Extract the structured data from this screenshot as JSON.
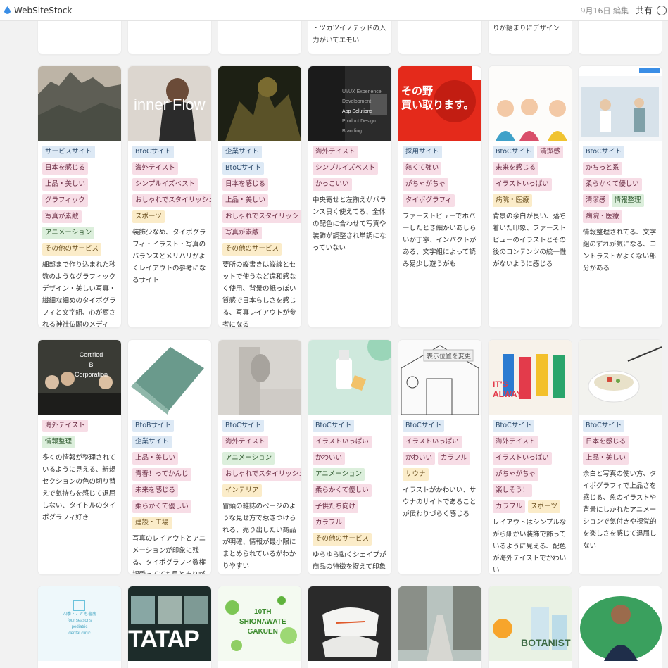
{
  "app": {
    "title": "WebSiteStock",
    "edit_date": "9月16日 編集",
    "share": "共有"
  },
  "colors": {
    "accent": "#3a8ee6",
    "tag_blue": "#dde9f5",
    "tag_pink": "#f7dde6",
    "tag_green": "#dcefdc",
    "tag_yellow": "#fbecc9"
  },
  "row0": [
    {
      "desc": ""
    },
    {
      "desc": ""
    },
    {
      "desc": ""
    },
    {
      "desc": "・ツカツイノテッドの入力がいてエモい"
    },
    {
      "desc": ""
    },
    {
      "desc": "りが語まりにデザイン"
    },
    {
      "desc": ""
    }
  ],
  "row1": [
    {
      "thumb_alt": "mountains-photo",
      "tags": [
        [
          "サービスサイト",
          "blue"
        ],
        [
          "日本を感じる",
          "pink"
        ],
        [
          "上品・美しい",
          "pink"
        ],
        [
          "グラフィック",
          "pink"
        ],
        [
          "写真が素敵",
          "pink"
        ],
        [
          "アニメーション",
          "green"
        ],
        [
          "その他のサービス",
          "yellow"
        ]
      ],
      "desc": "細部まで作り込まれた秒数のようなグラフィックデザイン・美しい写真・繊細な細めのタイポグラフィと文字組、心が癒される神社仏閣のメディア、読み物としても読み応えがある"
    },
    {
      "thumb_alt": "inner-flow-photo",
      "overlay": "inner Flow",
      "tags": [
        [
          "BtoCサイト",
          "blue"
        ],
        [
          "海外テイスト",
          "pink"
        ],
        [
          "シンプルイズベスト",
          "pink"
        ],
        [
          "おしゃれでスタイリッシュ",
          "pink"
        ],
        [
          "スポーツ",
          "yellow"
        ]
      ],
      "desc": "装飾少なめ、タイポグラフィ・イラスト・写真のバランスとメリハリがよくレイアウトの参考になるサイト"
    },
    {
      "thumb_alt": "dark-nature-photo",
      "tags": [
        [
          "企業サイト",
          "blue"
        ],
        [
          "BtoCサイト",
          "blue"
        ],
        [
          "日本を感じる",
          "pink"
        ],
        [
          "上品・美しい",
          "pink"
        ],
        [
          "おしゃれでスタイリッシュ",
          "pink"
        ],
        [
          "写真が素敵",
          "pink"
        ],
        [
          "その他のサービス",
          "yellow"
        ]
      ],
      "desc": "要所の縦書きは縦線とセットで使うなど違和感なく使用、背景の紙っぽい質感で日本らしさを感じる、写真レイアウトが参考になる"
    },
    {
      "thumb_alt": "app-solutions-screen",
      "overlay_lines": [
        "UI/UX Experience",
        "Development",
        "App Solutions",
        "Product Design",
        "Branding"
      ],
      "tags": [
        [
          "海外テイスト",
          "pink"
        ],
        [
          "シンプルイズベスト",
          "pink"
        ],
        [
          "かっこいい",
          "pink"
        ]
      ],
      "desc": "中央寄せと左揃えがバランス良く使えてる、全体の配色に合わせて写真や装飾が調整され単調になっていない"
    },
    {
      "thumb_alt": "red-buy-screen",
      "overlay_lines": [
        "その野",
        "買い取ります。"
      ],
      "tags": [
        [
          "採用サイト",
          "blue"
        ],
        [
          "熱くて強い",
          "pink"
        ],
        [
          "がちゃがちゃ",
          "pink"
        ],
        [
          "タイポグラフィ",
          "pink"
        ]
      ],
      "desc": "ファーストビューでホバーしたとき細かいあしらいが丁寧、インパクトがある、文字組によって読み易少し遊うがも"
    },
    {
      "thumb_alt": "illustration-people",
      "tags": [
        [
          "BtoCサイト",
          "blue"
        ],
        [
          "清潔感",
          "pink"
        ],
        [
          "未来を感じる",
          "pink"
        ],
        [
          "イラストいっぱい",
          "pink"
        ],
        [
          "病院・医療",
          "yellow"
        ]
      ],
      "desc": "背景の余白が良い、落ち着いた印象、ファーストビューのイラストとその後のコンテンツの統一性がないように感じる"
    },
    {
      "thumb_alt": "medical-photo",
      "tags": [
        [
          "BtoCサイト",
          "blue"
        ],
        [
          "かちっと系",
          "pink"
        ],
        [
          "柔らかくて優しい",
          "pink"
        ],
        [
          "清潔感",
          "pink"
        ],
        [
          "情報整理",
          "green"
        ],
        [
          "病院・医療",
          "pink"
        ]
      ],
      "desc": "情報整理されてる、文字組のずれが気になる、コントラストがよくない部分がある"
    }
  ],
  "row2": [
    {
      "thumb_alt": "certified-b-people",
      "overlay_lines": [
        "Certified",
        "B",
        "Corporation"
      ],
      "tags": [
        [
          "海外テイスト",
          "pink"
        ],
        [
          "情報整理",
          "green"
        ]
      ],
      "desc": "多くの情報が整理されているように見える、新規セクションの色の切り替えで気持ちを感じて退屈しない、タイトルのタイポグラフィ好き"
    },
    {
      "thumb_alt": "tilted-building",
      "tags": [
        [
          "BtoBサイト",
          "blue"
        ],
        [
          "企業サイト",
          "blue"
        ],
        [
          "上品・美しい",
          "pink"
        ],
        [
          "青春！ってかんじ",
          "pink"
        ],
        [
          "未来を感じる",
          "pink"
        ],
        [
          "柔らかくて優しい",
          "pink"
        ],
        [
          "建設・工場",
          "yellow"
        ]
      ],
      "desc": "写真のレイアウトとアニメーションが印象に残る、タイポグラフィ数権認受ってても目とまりがある"
    },
    {
      "thumb_alt": "gray-product",
      "tags": [
        [
          "BtoCサイト",
          "blue"
        ],
        [
          "海外テイスト",
          "pink"
        ],
        [
          "アニメーション",
          "green"
        ],
        [
          "おしゃれでスタイリッシュ",
          "pink"
        ],
        [
          "インテリア",
          "yellow"
        ]
      ],
      "desc": "冒頭の雑誌のページのような見せ方で惹きつけられる、売り出したい商品が明確、情報が最小限にまとめられているがわかりやすい"
    },
    {
      "thumb_alt": "green-bottle",
      "tags": [
        [
          "BtoCサイト",
          "blue"
        ],
        [
          "イラストいっぱい",
          "pink"
        ],
        [
          "かわいい",
          "pink"
        ],
        [
          "アニメーション",
          "green"
        ],
        [
          "柔らかくて優しい",
          "pink"
        ],
        [
          "子供たち向け",
          "pink"
        ],
        [
          "カラフル",
          "pink"
        ],
        [
          "その他のサービス",
          "yellow"
        ]
      ],
      "desc": "ゆらゆら動くシェイプが商品の特徴を捉えて印象に残る、写真素材が良い、キャッチコピーが映えている"
    },
    {
      "thumb_alt": "sketch-house",
      "overlay": "表示位置を変更",
      "tags": [
        [
          "BtoCサイト",
          "blue"
        ],
        [
          "イラストいっぱい",
          "pink"
        ],
        [
          "かわいい",
          "pink"
        ],
        [
          "カラフル",
          "pink"
        ],
        [
          "サウナ",
          "yellow"
        ]
      ],
      "desc": "イラストがかわいい、サウナのサイトであることが伝わりづらく感じる"
    },
    {
      "thumb_alt": "colorful-models",
      "overlay_lines": [
        "IT'S",
        "ALWAYS"
      ],
      "tags": [
        [
          "BtoCサイト",
          "blue"
        ],
        [
          "海外テイスト",
          "pink"
        ],
        [
          "イラストいっぱい",
          "pink"
        ],
        [
          "がちゃがちゃ",
          "pink"
        ],
        [
          "楽しそう！",
          "pink"
        ],
        [
          "カラフル",
          "pink"
        ],
        [
          "スポーツ",
          "yellow"
        ]
      ],
      "desc": "レイアウトはシンプルながら細かい装飾で飾っているように見える、配色が海外テイストでかわいい"
    },
    {
      "thumb_alt": "food-bowl",
      "tags": [
        [
          "BtoCサイト",
          "blue"
        ],
        [
          "日本を感じる",
          "pink"
        ],
        [
          "上品・美しい",
          "pink"
        ]
      ],
      "desc": "余白と写真の使い方、タイポグラフィで上品さを感じる、魚のイラストや背景にしかれたアニメーションで気付きや視覚的を楽しさを感じて退屈しない"
    }
  ],
  "row3": [
    {
      "thumb_alt": "light-blue-logo",
      "overlay_lines": [
        "四季・こども書房",
        "four seasons",
        "pediatric",
        "dental clinic"
      ]
    },
    {
      "thumb_alt": "tatap-photos",
      "overlay": "TATAP"
    },
    {
      "thumb_alt": "green-10th",
      "overlay_lines": [
        "10TH",
        "SHIONAWATE",
        "GAKUEN"
      ]
    },
    {
      "thumb_alt": "white-shoes"
    },
    {
      "thumb_alt": "street-photo"
    },
    {
      "thumb_alt": "botanist",
      "overlay": "BOTANIST"
    },
    {
      "thumb_alt": "person-green"
    }
  ]
}
